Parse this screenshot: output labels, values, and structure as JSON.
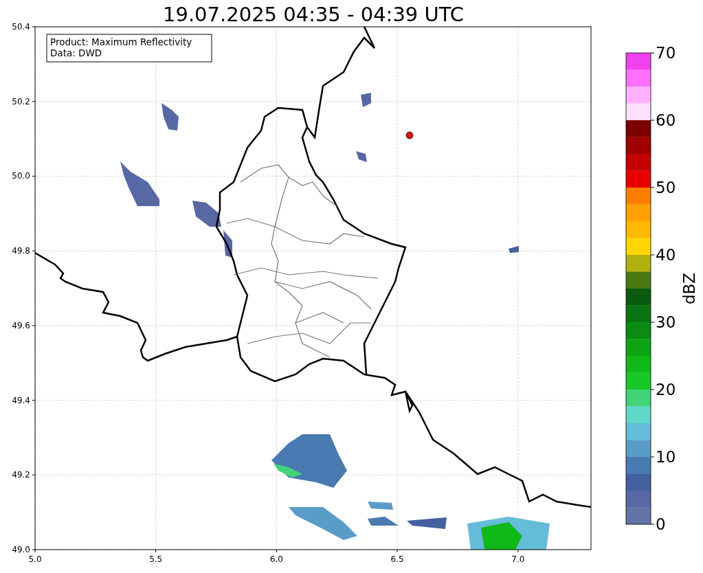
{
  "title": "19.07.2025 04:35 - 04:39 UTC",
  "info_box": {
    "lines": [
      "Product: Maximum Reflectivity",
      "Data: DWD"
    ]
  },
  "x_ticks": [
    "5.0",
    "5.5",
    "6.0",
    "6.5",
    "7.0"
  ],
  "y_ticks": [
    "50.4",
    "50.2",
    "50.0",
    "49.8",
    "49.6",
    "49.4",
    "49.2",
    "49.0"
  ],
  "colorbar": {
    "label": "dBZ",
    "ticks": [
      "70",
      "60",
      "50",
      "40",
      "30",
      "20",
      "10",
      "0"
    ],
    "bins": [
      {
        "color": "#f040f0"
      },
      {
        "color": "#ff70ff"
      },
      {
        "color": "#ffb0ff"
      },
      {
        "color": "#ffe0ff"
      },
      {
        "color": "#7c0000"
      },
      {
        "color": "#a00000"
      },
      {
        "color": "#c40000"
      },
      {
        "color": "#e80000"
      },
      {
        "color": "#ff7e00"
      },
      {
        "color": "#ffa000"
      },
      {
        "color": "#ffb800"
      },
      {
        "color": "#ffd600"
      },
      {
        "color": "#b0b010"
      },
      {
        "color": "#487810"
      },
      {
        "color": "#0a5a10"
      },
      {
        "color": "#0a7414"
      },
      {
        "color": "#0a8c14"
      },
      {
        "color": "#0ca414"
      },
      {
        "color": "#10b818"
      },
      {
        "color": "#18c828"
      },
      {
        "color": "#40d478"
      },
      {
        "color": "#60d8c8"
      },
      {
        "color": "#64bcd8"
      },
      {
        "color": "#5a9cc8"
      },
      {
        "color": "#4a7ab2"
      },
      {
        "color": "#4560a0"
      },
      {
        "color": "#5868a4"
      },
      {
        "color": "#6474a6"
      }
    ]
  }
}
